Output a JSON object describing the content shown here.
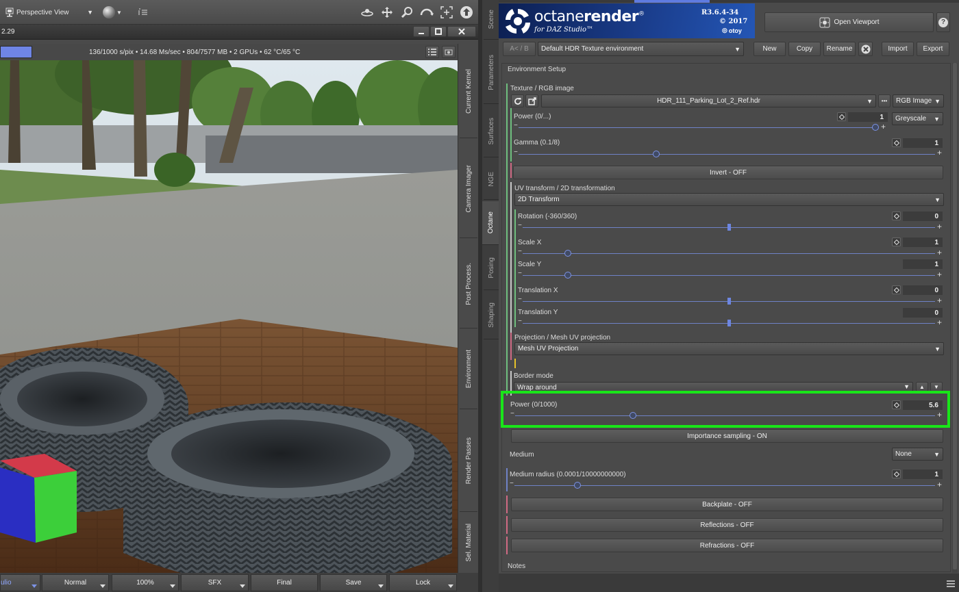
{
  "viewport": {
    "view_selector": "Perspective View",
    "window_title_fragment": "2.29",
    "status_bar": "136/1000 s/pix • 14.68 Ms/sec • 804/7577 MB • 2 GPUs • 62 °C/65 °C",
    "progress": 0.136,
    "side_tabs": [
      "Current Kernel",
      "Camera Imager",
      "Post Process.",
      "Environment",
      "Render Passes",
      "Sel. Material"
    ],
    "bottom_bar": [
      "ulio",
      "Normal",
      "100%",
      "SFX",
      "Final",
      "Save",
      "Lock"
    ]
  },
  "dock_tabs": [
    "Scene",
    "Parameters",
    "Surfaces",
    "NGE",
    "Octane",
    "Posing",
    "Shaping"
  ],
  "banner": {
    "brand_main": "octane",
    "brand_bold": "render",
    "reg": "®",
    "subtitle": "for DAZ Studio™",
    "version": "R3.6.4-34",
    "year": "© 2017",
    "company": "otoy"
  },
  "toolbar": {
    "open_viewport": "Open Viewport",
    "help": "?",
    "ab": "A< / B",
    "preset": "Default HDR Texture environment",
    "new": "New",
    "copy": "Copy",
    "rename": "Rename",
    "import": "Import",
    "export": "Export"
  },
  "panel": {
    "section_title": "Environment Setup",
    "texture_label": "Texture / RGB image",
    "file_name": "HDR_111_Parking_Lot_2_Ref.hdr",
    "file_more": "•••",
    "rgb_type": "RGB Image",
    "power_tex": {
      "label": "Power (0/...)",
      "value": "1",
      "fraction": 1.0,
      "mode": "Greyscale"
    },
    "gamma": {
      "label": "Gamma (0.1/8)",
      "value": "1",
      "fraction": 0.33
    },
    "invert": "Invert - OFF",
    "uv_label": "UV transform / 2D transformation",
    "uv_type": "2D Transform",
    "rotation": {
      "label": "Rotation (-360/360)",
      "value": "0",
      "fraction": 0.5
    },
    "scale_x": {
      "label": "Scale X",
      "value": "1",
      "fraction": 0.11
    },
    "scale_y": {
      "label": "Scale Y",
      "value": "1",
      "fraction": 0.11
    },
    "translation_x": {
      "label": "Translation X",
      "value": "0",
      "fraction": 0.5
    },
    "translation_y": {
      "label": "Translation Y",
      "value": "0",
      "fraction": 0.5
    },
    "projection_label": "Projection / Mesh UV projection",
    "projection_type": "Mesh UV Projection",
    "border_label": "Border mode",
    "border_value": "Wrap around",
    "power_env": {
      "label": "Power (0/1000)",
      "value": "5.6",
      "fraction": 0.28
    },
    "importance": "Importance sampling - ON",
    "medium_label": "Medium",
    "medium_value": "None",
    "medium_radius": {
      "label": "Medium radius (0.0001/10000000000)",
      "value": "1",
      "fraction": 0.15
    },
    "backplate": "Backplate - OFF",
    "reflections": "Reflections - OFF",
    "refractions": "Refractions - OFF",
    "notes": "Notes"
  },
  "colors": {
    "highlight": "#19e619",
    "slider": "#6d86e0",
    "banner": "#1b3f8f"
  }
}
